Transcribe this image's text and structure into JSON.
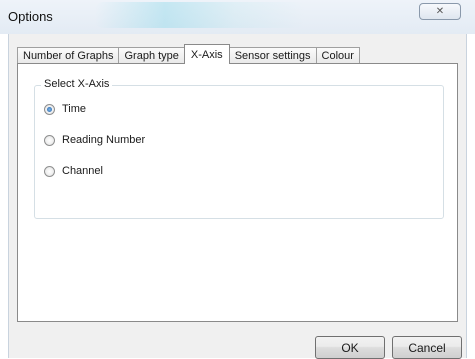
{
  "window": {
    "title": "Options",
    "close_glyph": "✕"
  },
  "tabs": [
    {
      "label": "Number of Graphs"
    },
    {
      "label": "Graph type"
    },
    {
      "label": "X-Axis",
      "active": true
    },
    {
      "label": "Sensor settings"
    },
    {
      "label": "Colour"
    }
  ],
  "xaxis": {
    "group_label": "Select X-Axis",
    "options": [
      {
        "label": "Time",
        "checked": true
      },
      {
        "label": "Reading Number",
        "checked": false
      },
      {
        "label": "Channel",
        "checked": false
      }
    ]
  },
  "buttons": {
    "ok": "OK",
    "cancel": "Cancel"
  },
  "colors": {
    "radio_selected": "#1e5fa8",
    "title_bar": "#e3ebf4",
    "dialog_bg": "#f0f0f0"
  }
}
